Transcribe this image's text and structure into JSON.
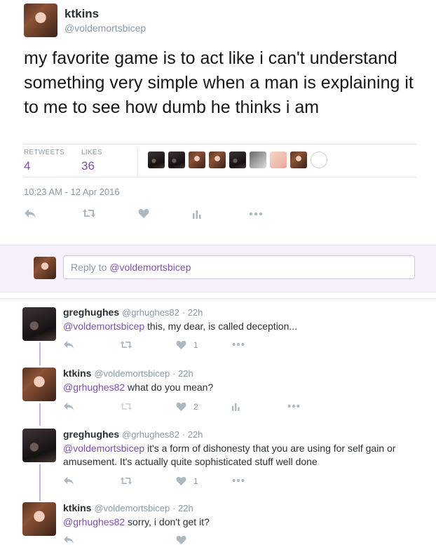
{
  "tweet": {
    "author_name": "ktkins",
    "author_handle": "@voldemortsbicep",
    "text": "my favorite game is to act like i can't understand something very simple when a man is explaining it to me to see how dumb he thinks i am",
    "retweets_label": "RETWEETS",
    "retweets_count": "4",
    "likes_label": "LIKES",
    "likes_count": "36",
    "timestamp": "10:23 AM - 12 Apr 2016"
  },
  "reply_box": {
    "placeholder_prefix": "Reply to ",
    "placeholder_handle": "@voldemortsbicep"
  },
  "replies": [
    {
      "name": "greghughes",
      "handle": "@grhughes82",
      "time": "· 22h",
      "mention": "@voldemortsbicep",
      "text": " this, my dear, is called deception...",
      "likes": "1"
    },
    {
      "name": "ktkins",
      "handle": "@voldemortsbicep",
      "time": "· 22h",
      "mention": "@grhughes82",
      "text": " what do you mean?",
      "likes": "2"
    },
    {
      "name": "greghughes",
      "handle": "@grhughes82",
      "time": "· 22h",
      "mention": "@voldemortsbicep",
      "text": " it's a form of dishonesty that you are using for self gain or amusement. It's actually quite sophisticated stuff well done",
      "likes": "1"
    },
    {
      "name": "ktkins",
      "handle": "@voldemortsbicep",
      "time": "· 22h",
      "mention": "@grhughes82",
      "text": " sorry, i don't get it?",
      "likes": ""
    }
  ],
  "colors": {
    "accent": "#7e4fa6",
    "muted": "#8899a6",
    "reply_bg": "#f5f0fa"
  },
  "icons": [
    "reply-icon",
    "retweet-icon",
    "heart-icon",
    "analytics-icon",
    "more-icon"
  ]
}
